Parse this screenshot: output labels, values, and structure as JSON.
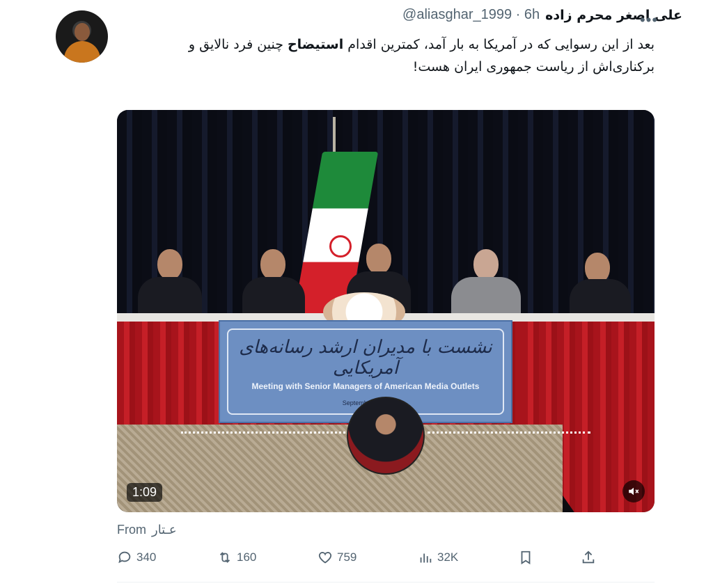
{
  "tweet": {
    "display_name": "علی اصغر محرم زاده",
    "handle": "@aliasghar_1999",
    "separator": "·",
    "time": "6h",
    "text_line1_part1": "بعد از این رسوایی که در آمریکا به بار آمد، کمترین اقدام ",
    "text_bold": "استیضاح",
    "text_line1_part2": " چنین فرد نالایق و",
    "text_line2": "برکناری‌اش از ریاست جمهوری ایران هست!",
    "more_icon": "more-horizontal-icon"
  },
  "media": {
    "banner_persian": "نشست با مدیران ارشد رسانه‌های آمریکایی",
    "banner_english": "Meeting with Senior Managers of American Media Outlets",
    "banner_date": "September 2024",
    "duration": "1:09",
    "mute_icon": "volume-muted-icon"
  },
  "source": {
    "label": "From",
    "name": "عـتار"
  },
  "actions": {
    "replies": "340",
    "retweets": "160",
    "likes": "759",
    "views": "32K"
  },
  "colors": {
    "secondary_text": "#536471",
    "primary_text": "#0f1419"
  }
}
